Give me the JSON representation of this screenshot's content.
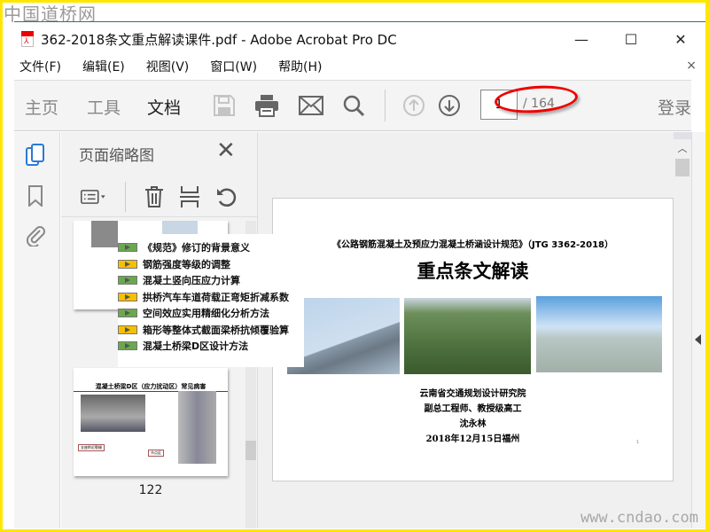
{
  "watermark_top": "中国道桥网",
  "watermark_bottom": "www.cndao.com",
  "window": {
    "title": "362-2018条文重点解读课件.pdf - Adobe Acrobat Pro DC",
    "minimize": "—",
    "maximize": "☐",
    "close": "✕"
  },
  "menu": [
    "文件(F)",
    "编辑(E)",
    "视图(V)",
    "窗口(W)",
    "帮助(H)"
  ],
  "menu_close": "×",
  "toolbar": {
    "tabs": [
      "主页",
      "工具",
      "文档"
    ],
    "active_tab": "文档",
    "page_current": "1",
    "page_total": "/ 164",
    "login": "登录"
  },
  "panel": {
    "title": "页面缩略图",
    "close": "✕"
  },
  "thumbnail_overlay": [
    {
      "text": "《规范》修订的背景意义",
      "color": "#6aa84f"
    },
    {
      "text": "钢筋强度等级的调整",
      "color": "#f6c000"
    },
    {
      "text": "混凝土竖向压应力计算",
      "color": "#6aa84f"
    },
    {
      "text": "拱桥汽车车道荷载正弯矩折减系数",
      "color": "#f6c000"
    },
    {
      "text": "空间效应实用精细化分析方法",
      "color": "#6aa84f"
    },
    {
      "text": "箱形等整体式截面梁桥抗倾覆验算",
      "color": "#f6c000"
    },
    {
      "text": "混凝土桥梁D区设计方法",
      "color": "#6aa84f"
    }
  ],
  "thumbnail_122": {
    "heading": "混凝土桥梁D区（应力扰动区）常见病害",
    "label1": "支座附近裂缝",
    "label2": "节点区",
    "page_label": "122"
  },
  "document_page": {
    "subtitle": "《公路钢筋混凝土及预应力混凝土桥涵设计规范》（JTG 3362-2018）",
    "title": "重点条文解读",
    "org": "云南省交通规划设计研究院",
    "role": "副总工程师、教授级高工",
    "author": "沈永林",
    "date": "2018年12月15日福州",
    "page_no": "1"
  },
  "colors": {
    "accent_highlight": "#e00000",
    "border": "#ffe600"
  }
}
